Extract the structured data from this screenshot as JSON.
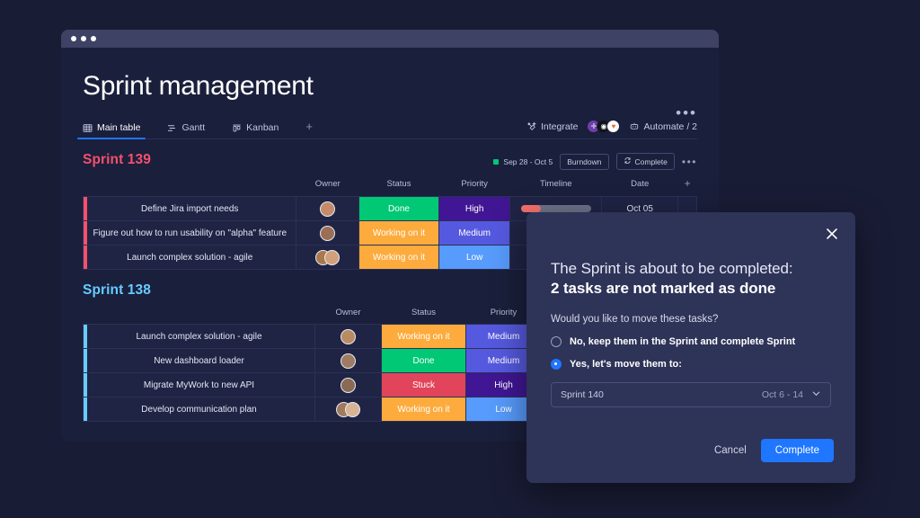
{
  "window": {
    "title": "Sprint management",
    "kebab_label": "•••"
  },
  "tabs": {
    "items": [
      {
        "label": "Main table",
        "icon": "table-icon",
        "active": true
      },
      {
        "label": "Gantt",
        "icon": "gantt-icon",
        "active": false
      },
      {
        "label": "Kanban",
        "icon": "kanban-icon",
        "active": false
      }
    ],
    "add_label": "+",
    "integrate_label": "Integrate",
    "automate_label": "Automate / 2",
    "integration_avatars": [
      "monday-icon",
      "github-icon",
      "mailchimp-icon"
    ]
  },
  "columns": {
    "name": "",
    "owner": "Owner",
    "status": "Status",
    "priority": "Priority",
    "timeline": "Timeline",
    "date": "Date",
    "add": "+"
  },
  "colors": {
    "done": "#00c875",
    "working": "#fdab3d",
    "stuck": "#e2445c",
    "high": "#401694",
    "medium": "#5559df",
    "low": "#579bfc",
    "sprint139_accent": "#f4516c",
    "sprint138_accent": "#66ccff",
    "primary": "#1f76ff",
    "timeline_fill": "#f4706e"
  },
  "groups": [
    {
      "title": "Sprint 139",
      "color": "#f4516c",
      "date_range": "Sep 28 - Oct 5",
      "burndown_label": "Burndown",
      "complete_label": "Complete",
      "kebab_label": "•••",
      "show_headers": true,
      "show_timeline": true,
      "rows": [
        {
          "name": "Define Jira import needs",
          "status": "Done",
          "status_color": "#00c875",
          "priority": "High",
          "priority_color": "#401694",
          "timeline_pct": 28,
          "date": "Oct 05",
          "owners": [
            "#c48a6a"
          ]
        },
        {
          "name": "Figure out how to run usability on \"alpha\" feature",
          "status": "Working on it",
          "status_color": "#fdab3d",
          "priority": "Medium",
          "priority_color": "#5559df",
          "timeline_pct": 0,
          "date": "",
          "owners": [
            "#9b6f55"
          ]
        },
        {
          "name": "Launch complex solution - agile",
          "status": "Working on it",
          "status_color": "#fdab3d",
          "priority": "Low",
          "priority_color": "#579bfc",
          "timeline_pct": 0,
          "date": "",
          "owners": [
            "#a8784f",
            "#d2a079"
          ]
        }
      ]
    },
    {
      "title": "Sprint 138",
      "color": "#66ccff",
      "date_range": "",
      "burndown_label": "",
      "complete_label": "",
      "kebab_label": "",
      "show_headers": true,
      "show_timeline": false,
      "rows": [
        {
          "name": "Launch complex solution - agile",
          "status": "Working on it",
          "status_color": "#fdab3d",
          "priority": "Medium",
          "priority_color": "#5559df",
          "timeline_pct": 0,
          "date": "",
          "owners": [
            "#b98b62"
          ]
        },
        {
          "name": "New dashboard loader",
          "status": "Done",
          "status_color": "#00c875",
          "priority": "Medium",
          "priority_color": "#5559df",
          "timeline_pct": 0,
          "date": "",
          "owners": [
            "#9e7b63"
          ]
        },
        {
          "name": "Migrate MyWork to new API",
          "status": "Stuck",
          "status_color": "#e2445c",
          "priority": "High",
          "priority_color": "#401694",
          "timeline_pct": 0,
          "date": "",
          "owners": [
            "#8a6a52"
          ]
        },
        {
          "name": "Develop communication plan",
          "status": "Working on it",
          "status_color": "#fdab3d",
          "priority": "Low",
          "priority_color": "#579bfc",
          "timeline_pct": 0,
          "date": "",
          "owners": [
            "#a07a5c",
            "#d8b495"
          ]
        }
      ]
    }
  ],
  "modal": {
    "close_label": "×",
    "heading_line1": "The Sprint is about to be completed:",
    "heading_line2": "2 tasks are not marked as done",
    "question": "Would you like to move these tasks?",
    "option_keep": "No, keep them in the Sprint and complete Sprint",
    "option_move": "Yes, let's move them to:",
    "selected_option": "move",
    "select_value": "Sprint 140",
    "select_date": "Oct 6 - 14",
    "select_chevron": "chevron-down-icon",
    "cancel_label": "Cancel",
    "complete_label": "Complete"
  }
}
